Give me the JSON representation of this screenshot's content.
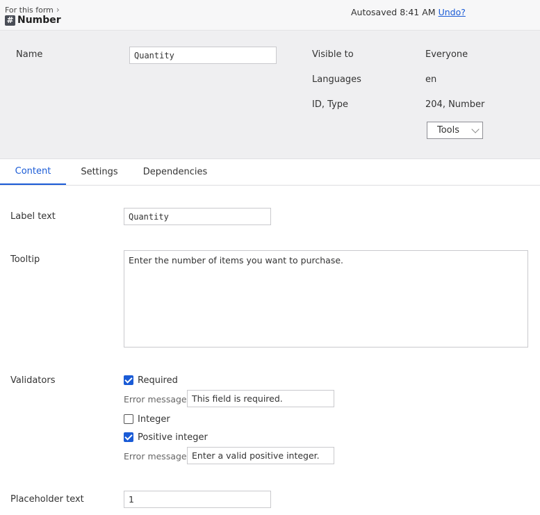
{
  "header": {
    "breadcrumb": "For this form",
    "icon": "hash-icon",
    "icon_glyph": "#",
    "title": "Number",
    "autosave_text": "Autosaved 8:41 AM",
    "undo_label": "Undo?"
  },
  "properties": {
    "name_label": "Name",
    "name_value": "Quantity",
    "visible_to_label": "Visible to",
    "visible_to_value": "Everyone",
    "languages_label": "Languages",
    "languages_value": "en",
    "id_type_label": "ID, Type",
    "id_type_value": "204, Number",
    "tools_label": "Tools"
  },
  "tabs": [
    {
      "label": "Content",
      "active": true
    },
    {
      "label": "Settings",
      "active": false
    },
    {
      "label": "Dependencies",
      "active": false
    }
  ],
  "content": {
    "label_text_label": "Label text",
    "label_text_value": "Quantity",
    "tooltip_label": "Tooltip",
    "tooltip_value": "Enter the number of items you want to purchase.",
    "validators_label": "Validators",
    "validators": {
      "required": {
        "label": "Required",
        "checked": true,
        "error_label": "Error message",
        "error_value": "This field is required."
      },
      "integer": {
        "label": "Integer",
        "checked": false
      },
      "positive_integer": {
        "label": "Positive integer",
        "checked": true,
        "error_label": "Error message",
        "error_value": "Enter a valid positive integer."
      }
    },
    "placeholder_label": "Placeholder text",
    "placeholder_value": "1"
  },
  "colors": {
    "accent": "#1a5bd6",
    "header_bg": "#f7f7f8",
    "panel_bg": "#efeff1"
  }
}
